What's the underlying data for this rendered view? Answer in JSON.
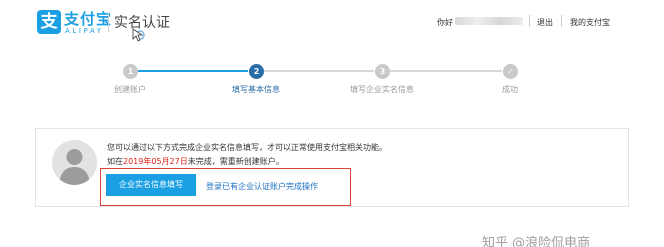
{
  "header": {
    "logo_mark": "支",
    "brand_cn": "支付宝",
    "brand_en": "ALIPAY",
    "page_title": "实名认证",
    "greeting": "你好",
    "logout_label": "退出",
    "my_alipay_label": "我的支付宝"
  },
  "steps": [
    {
      "number": "1",
      "label": "创建账户",
      "state": "inactive"
    },
    {
      "number": "2",
      "label": "填写基本信息",
      "state": "active"
    },
    {
      "number": "3",
      "label": "填写企业实名信息",
      "state": "inactive"
    },
    {
      "number": "✓",
      "label": "成功",
      "state": "inactive"
    }
  ],
  "notice": {
    "line1": "您可以通过以下方式完成企业实名信息填写，才可以正常使用支付宝相关功能。",
    "line2_prefix": "如在",
    "line2_date": "2019年05月27日",
    "line2_suffix": "未完成，需重新创建账户。",
    "primary_button": "企业实名信息填写",
    "secondary_link": "登录已有企业认证账户完成操作"
  },
  "watermark": "知乎 @浪险侃电商",
  "colors": {
    "brand_blue": "#1a9fe3",
    "step_active": "#2a6ea8",
    "alert_red": "#e2231a"
  }
}
